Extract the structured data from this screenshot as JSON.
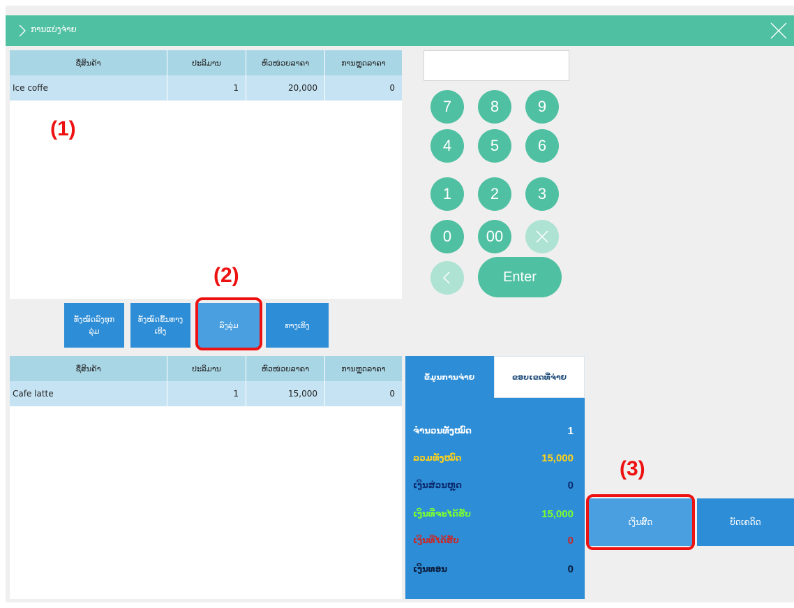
{
  "window": {
    "title": "ການແບ່ງຈ່າຍ"
  },
  "table_columns": [
    "ຊື່ສິນຄ້າ",
    "ປະລິມານ",
    "ຫົວໜ່ວຍລາຄາ",
    "ການຫຼຸດລາຄາ"
  ],
  "top_table": {
    "rows": [
      {
        "name": "Ice coffe",
        "qty": "1",
        "price": "20,000",
        "discount": "0"
      }
    ]
  },
  "bottom_table": {
    "rows": [
      {
        "name": "Cafe latte",
        "qty": "1",
        "price": "15,000",
        "discount": "0"
      }
    ]
  },
  "keypad": {
    "input_value": "",
    "keys": {
      "k7": "7",
      "k8": "8",
      "k9": "9",
      "k4": "4",
      "k5": "5",
      "k6": "6",
      "k1": "1",
      "k2": "2",
      "k3": "3",
      "k0": "0",
      "k00": "00"
    },
    "enter_label": "Enter"
  },
  "transfer_buttons": {
    "move_all_up": "ທັງໝົດລົງທຸກລຸ່ມ",
    "move_all_down": "ທັງໝົດຂຶ້ນທາງເທິງ",
    "down": "ລົງລຸ່ມ",
    "up": "ທາງເທິງ"
  },
  "summary": {
    "tab_active": "ຂໍ້ມູນການຈ່າຍ",
    "tab_inactive": "ຂອບເຂດທີ່ຈ່າຍ",
    "rows": [
      {
        "label": "ຈຳນວນທັງໝົດ",
        "value": "1",
        "label_color": "#ffffff",
        "value_color": "#ffffff"
      },
      {
        "label": "ລວມທັງໝົດ",
        "value": "15,000",
        "label_color": "#ffd21a",
        "value_color": "#ffd21a"
      },
      {
        "label": "ເງິນສ່ວນຫຼຸດ",
        "value": "0",
        "label_color": "#0b2a6e",
        "value_color": "#0b2a6e"
      },
      {
        "label": "ເງິນທີ່ຈະໄດ້ຮັບ",
        "value": "15,000",
        "label_color": "#7dff2e",
        "value_color": "#7dff2e"
      },
      {
        "label": "ເງິນທີ່ໄດ້ຮັບ",
        "value": "0",
        "label_color": "#c82828",
        "value_color": "#c82828"
      },
      {
        "label": "ເງິນທອນ",
        "value": "0",
        "label_color": "#0b1a3a",
        "value_color": "#0b1a3a"
      }
    ]
  },
  "actions": {
    "cash": "ເງິນສົດ",
    "card": "ບັດເຄດິດ"
  },
  "annotations": {
    "a1": "(1)",
    "a2": "(2)",
    "a3": "(3)"
  },
  "colors": {
    "accent_green": "#4fc0a1",
    "blue": "#2d8dd6",
    "highlight_red": "#e11111"
  }
}
